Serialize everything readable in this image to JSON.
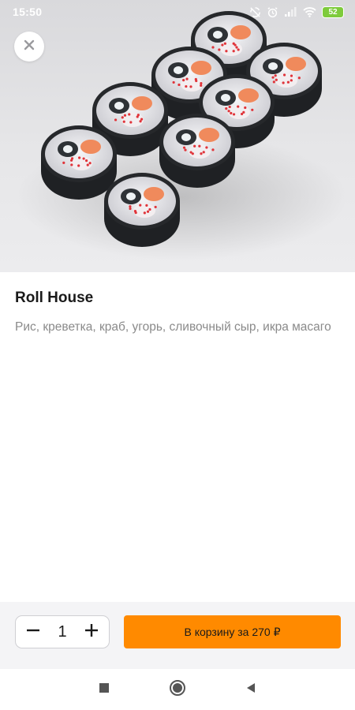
{
  "status_bar": {
    "time": "15:50",
    "battery": "52",
    "icons": [
      "sync-off-icon",
      "alarm-icon",
      "signal-icon",
      "wifi-icon",
      "battery-icon"
    ]
  },
  "hero": {
    "image": "sushi-rolls-photo",
    "close_icon": "close-icon"
  },
  "product": {
    "title": "Roll House",
    "description": "Рис, креветка, краб, угорь, сливочный сыр, икра масаго"
  },
  "order": {
    "quantity": "1",
    "decrease_icon": "minus-icon",
    "increase_icon": "plus-icon",
    "cart_label": "В корзину за 270 ₽"
  },
  "nav": {
    "icons": [
      "recents-icon",
      "home-icon",
      "back-icon"
    ]
  },
  "colors": {
    "accent": "#ff8a00",
    "battery": "#7ecb3c",
    "text_primary": "#1a1a1a",
    "text_secondary": "#8a8a8a",
    "action_bar_bg": "#f4f4f6"
  }
}
